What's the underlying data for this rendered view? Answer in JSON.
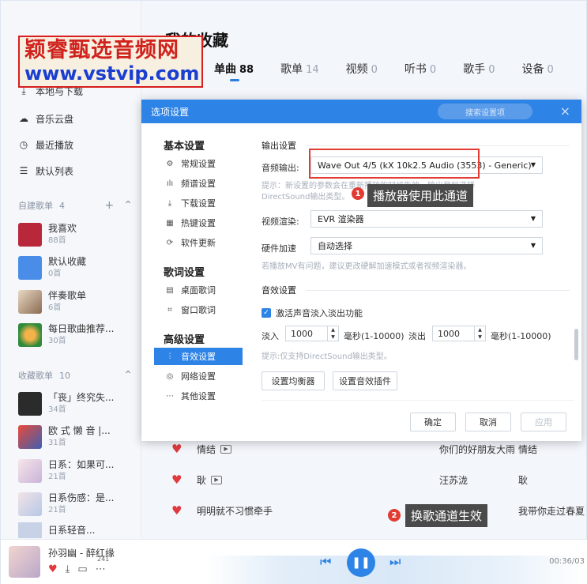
{
  "sidebar": {
    "nav": [
      {
        "label": "本地与下载",
        "icon": "download-icon"
      },
      {
        "label": "音乐云盘",
        "icon": "cloud-icon"
      },
      {
        "label": "最近播放",
        "icon": "clock-icon"
      },
      {
        "label": "默认列表",
        "icon": "list-icon"
      }
    ],
    "created_section": {
      "label": "自建歌单",
      "count": "4"
    },
    "created": [
      {
        "title": "我喜欢",
        "count": "88首"
      },
      {
        "title": "默认收藏",
        "count": "0首"
      },
      {
        "title": "伴奏歌单",
        "count": "6首"
      },
      {
        "title": "每日歌曲推荐...",
        "count": "30首"
      }
    ],
    "collected_section": {
      "label": "收藏歌单",
      "count": "10"
    },
    "collected": [
      {
        "title": "「丧」终究失...",
        "count": "34首"
      },
      {
        "title": "欧 式 懒 音 |...",
        "count": "31首"
      },
      {
        "title": "日系：如果可...",
        "count": "21首"
      },
      {
        "title": "日系伤感：是...",
        "count": "21首"
      },
      {
        "title": "日系轻音...",
        "count": ""
      }
    ]
  },
  "watermark": {
    "line1": "颖睿甄选音频网",
    "line2": "www.vstvip.com"
  },
  "main": {
    "title": "我的收藏",
    "tabs": [
      {
        "label": "单曲",
        "count": "88"
      },
      {
        "label": "歌单",
        "count": "14"
      },
      {
        "label": "视频",
        "count": "0"
      },
      {
        "label": "听书",
        "count": "0"
      },
      {
        "label": "歌手",
        "count": "0"
      },
      {
        "label": "设备",
        "count": "0"
      }
    ],
    "songs": [
      {
        "title": "情结",
        "artist": "你们的好朋友大雨",
        "album": "情结"
      },
      {
        "title": "耿",
        "artist": "汪苏泷",
        "album": "耿"
      },
      {
        "title": "明明就不习惯牵手",
        "artist": "",
        "album": "我带你走过春夏"
      }
    ]
  },
  "dialog": {
    "title": "选项设置",
    "search_placeholder": "搜索设置项",
    "close": "×",
    "nav_groups": [
      {
        "label": "基本设置",
        "items": [
          {
            "label": "常规设置",
            "icon": "gear-icon"
          },
          {
            "label": "频谱设置",
            "icon": "spectrum-icon"
          },
          {
            "label": "下载设置",
            "icon": "download-icon"
          },
          {
            "label": "热键设置",
            "icon": "keyboard-icon"
          },
          {
            "label": "软件更新",
            "icon": "update-icon"
          }
        ]
      },
      {
        "label": "歌词设置",
        "items": [
          {
            "label": "桌面歌词",
            "icon": "desktop-lyrics-icon"
          },
          {
            "label": "窗口歌词",
            "icon": "window-lyrics-icon"
          }
        ]
      },
      {
        "label": "高级设置",
        "items": [
          {
            "label": "音效设置",
            "icon": "equalizer-icon"
          },
          {
            "label": "网络设置",
            "icon": "network-icon"
          },
          {
            "label": "其他设置",
            "icon": "more-icon"
          }
        ]
      }
    ],
    "output": {
      "section": "输出设置",
      "audio_label": "音频输出:",
      "audio_value": "Wave Out 4/5 (kX 10k2.5 Audio (3553) - Generic)",
      "hint1": "提示：新设置的参数会在重新播放的时候生效。输出目标选择",
      "hint2": "DirectSound输出类型。",
      "video_label": "视频渲染:",
      "video_value": "EVR 渲染器",
      "hw_label": "硬件加速",
      "hw_value": "自动选择",
      "hint3": "若播放MV有问题，建议更改硬解加速模式或者视频渲染器。"
    },
    "effects": {
      "section": "音效设置",
      "fade_checkbox": "激活声音淡入淡出功能",
      "fade_in_label": "淡入",
      "fade_in_value": "1000",
      "fade_in_unit": "毫秒(1-10000)",
      "fade_out_label": "淡出",
      "fade_out_value": "1000",
      "fade_out_unit": "毫秒(1-10000)",
      "hint": "提示:仅支持DirectSound输出类型。",
      "eq_button": "设置均衡器",
      "plugin_button": "设置音效插件"
    },
    "ok": "确定",
    "cancel": "取消",
    "apply": "应用"
  },
  "annotations": [
    {
      "num": "1",
      "text": "播放器使用此通道"
    },
    {
      "num": "2",
      "text": "换歌通道生效"
    }
  ],
  "player": {
    "now_playing": "孙羽幽 - 醉红缘",
    "comment_count": "241",
    "time": "00:36/03"
  },
  "colors": {
    "accent": "#2e83e6",
    "annotation": "#e23b32"
  }
}
